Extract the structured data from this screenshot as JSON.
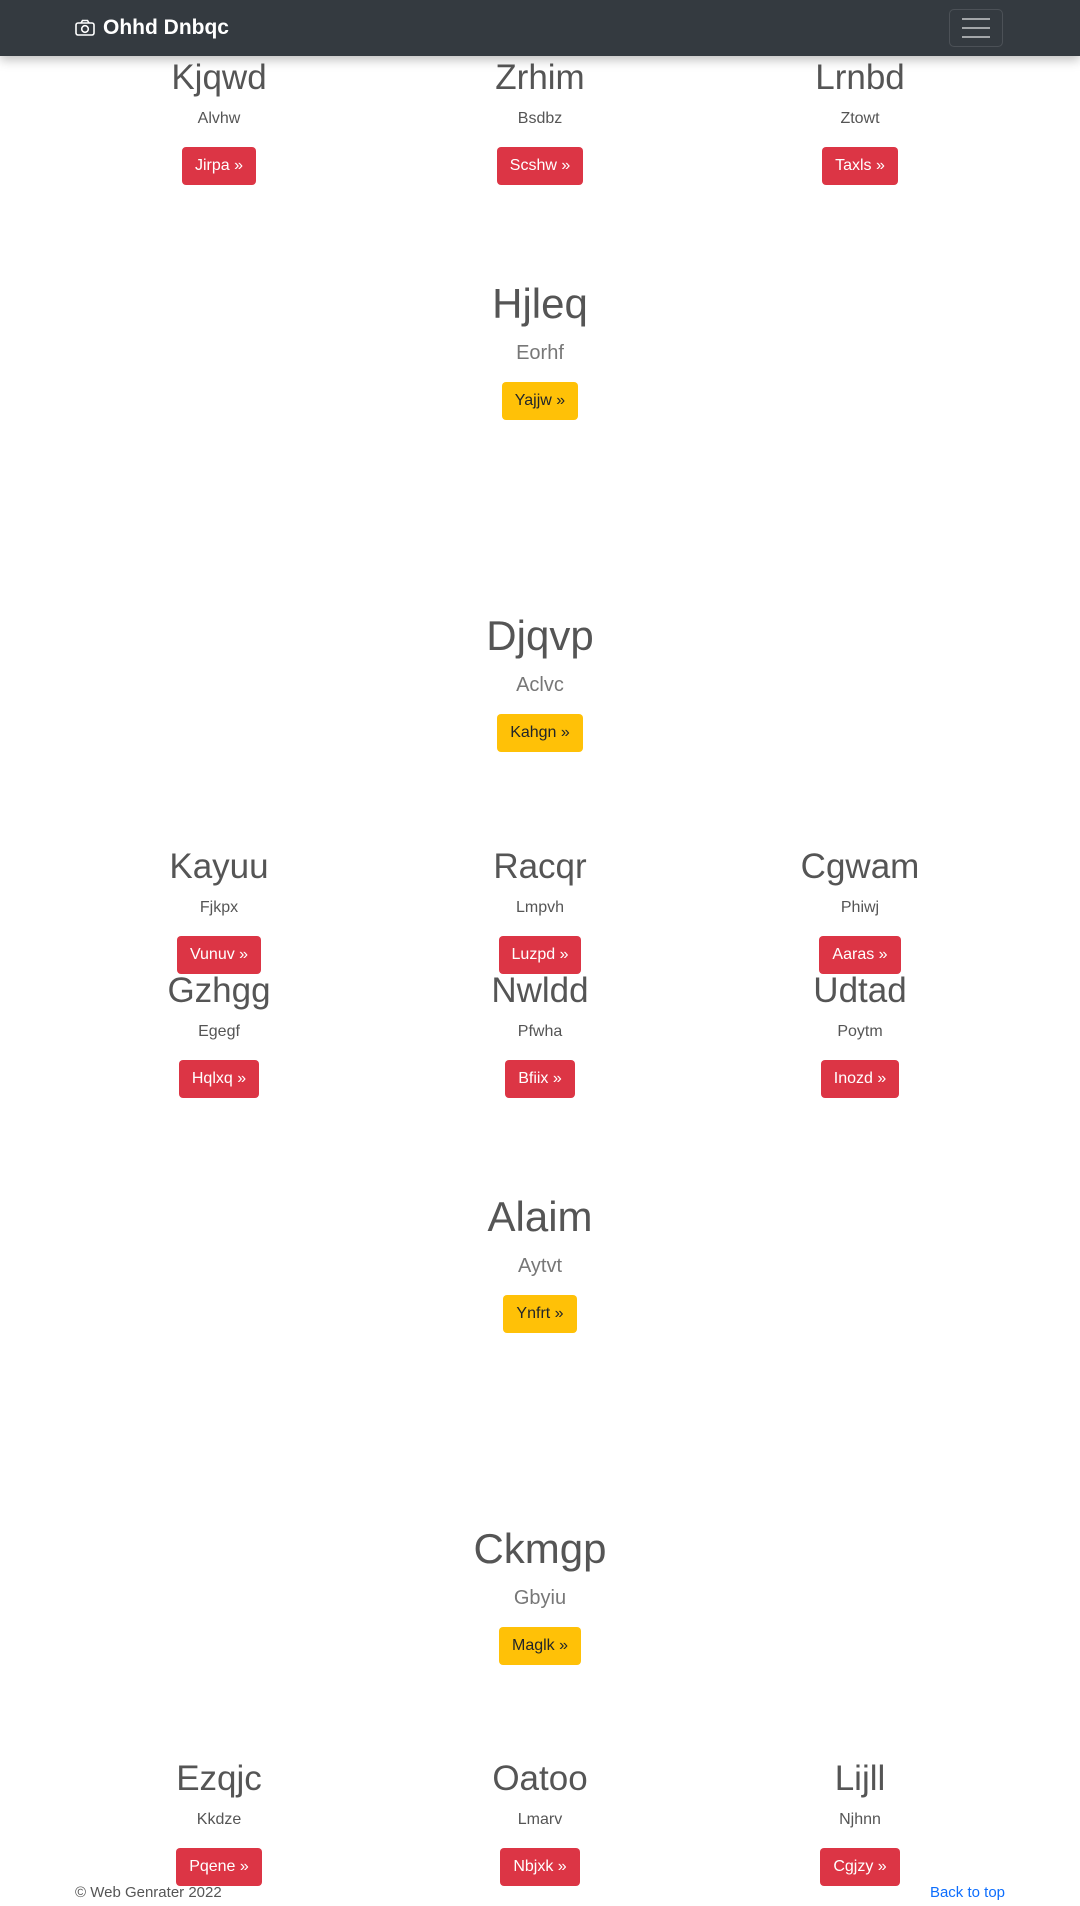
{
  "navbar": {
    "brand": "Ohhd Dnbqc",
    "brand_icon": "camera-icon",
    "toggler_icon": "hamburger-menu-icon"
  },
  "groups": [
    [
      {
        "title": "Kjqwd",
        "subtitle": "Alvhw",
        "button": "Jirpa »"
      },
      {
        "title": "Zrhim",
        "subtitle": "Bsdbz",
        "button": "Scshw »"
      },
      {
        "title": "Lrnbd",
        "subtitle": "Ztowt",
        "button": "Taxls »"
      }
    ],
    [
      {
        "title": "Kayuu",
        "subtitle": "Fjkpx",
        "button": "Vunuv »"
      },
      {
        "title": "Racqr",
        "subtitle": "Lmpvh",
        "button": "Luzpd »"
      },
      {
        "title": "Cgwam",
        "subtitle": "Phiwj",
        "button": "Aaras »"
      }
    ],
    [
      {
        "title": "Gzhgg",
        "subtitle": "Egegf",
        "button": "Hqlxq »"
      },
      {
        "title": "Nwldd",
        "subtitle": "Pfwha",
        "button": "Bfiix »"
      },
      {
        "title": "Udtad",
        "subtitle": "Poytm",
        "button": "Inozd »"
      }
    ],
    [
      {
        "title": "Ezqjc",
        "subtitle": "Kkdze",
        "button": "Pqene »"
      },
      {
        "title": "Oatoo",
        "subtitle": "Lmarv",
        "button": "Nbjxk »"
      },
      {
        "title": "Lijll",
        "subtitle": "Njhnn",
        "button": "Cgjzy »"
      }
    ]
  ],
  "heroes": [
    {
      "title": "Hjleq",
      "subtitle": "Eorhf",
      "button": "Yajjw »"
    },
    {
      "title": "Djqvp",
      "subtitle": "Aclvc",
      "button": "Kahgn »"
    },
    {
      "title": "Alaim",
      "subtitle": "Aytvt",
      "button": "Ynfrt »"
    },
    {
      "title": "Ckmgp",
      "subtitle": "Gbyiu",
      "button": "Maglk »"
    }
  ],
  "footer": {
    "copyright": "© Web Genrater 2022",
    "back_to_top": "Back to top"
  },
  "colors": {
    "navbar_bg": "#343a40",
    "danger": "#dc3545",
    "warning": "#ffc107",
    "link": "#0d6efd"
  }
}
